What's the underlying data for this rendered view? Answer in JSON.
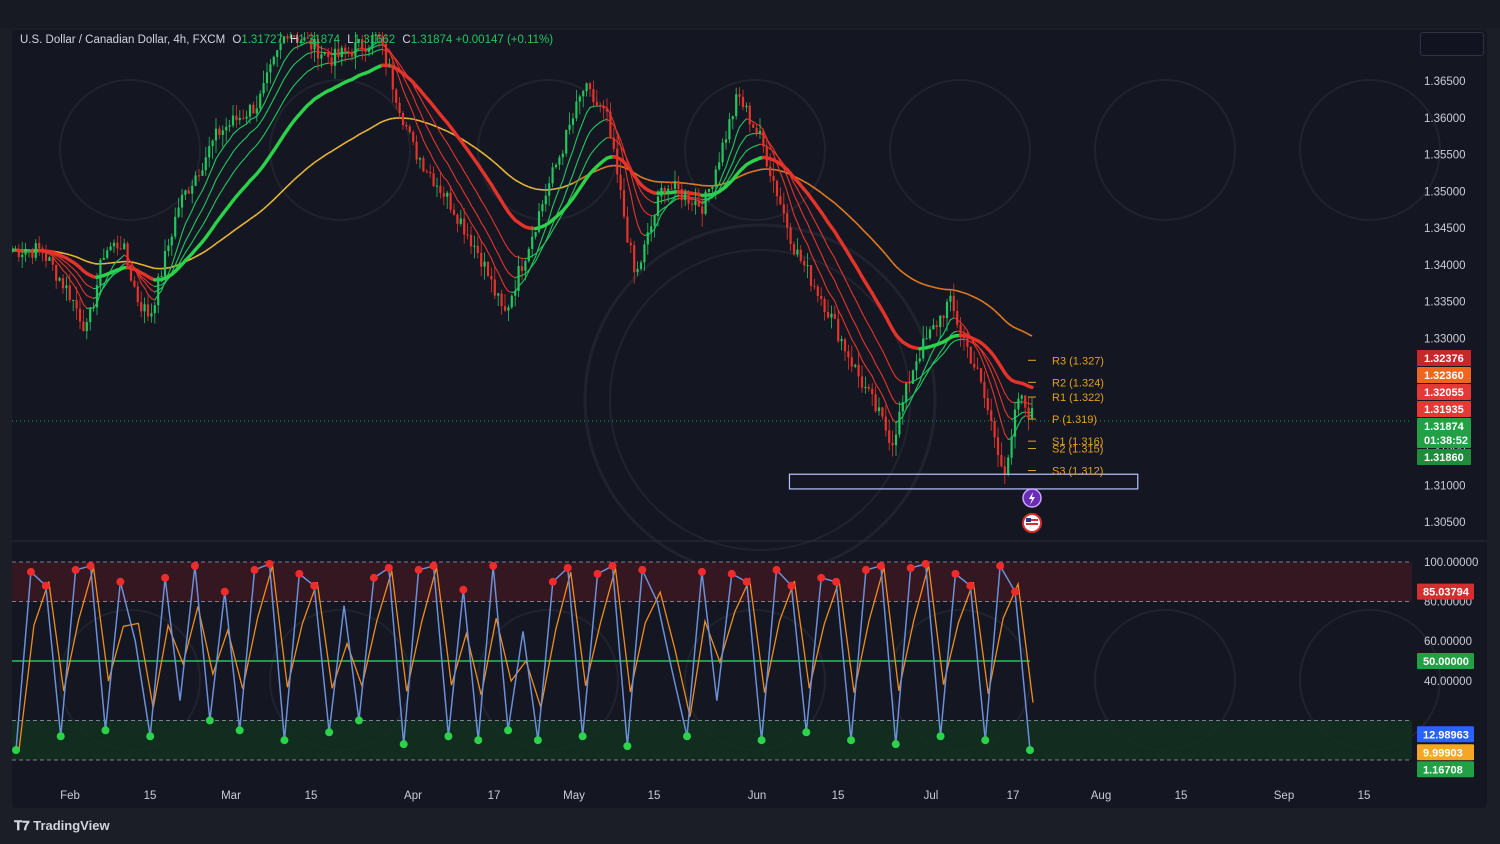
{
  "legend": {
    "symbol": "U.S. Dollar / Canadian Dollar, 4h, FXCM",
    "o_label": "O",
    "o": "1.31727",
    "h_label": "H",
    "h": "1.31874",
    "l_label": "L",
    "l": "1.31662",
    "c_label": "C",
    "c": "1.31874",
    "change": "+0.00147 (+0.11%)"
  },
  "footer": {
    "brand": "TradingView"
  },
  "colors": {
    "bull": "#22c55e",
    "bear": "#e5332a",
    "ema_yellow": "#e8b53a",
    "pivot": "#e0a020",
    "osc_blue": "#6b8fd8",
    "osc_orange": "#f08c1e",
    "zone_box": "#b8c4ff"
  },
  "chart_data": [
    {
      "type": "candlestick",
      "title": "U.S. Dollar / Canadian Dollar, 4h, FXCM",
      "ylim": [
        1.302,
        1.372
      ],
      "y_ticks": [
        "1.30500",
        "1.31000",
        "1.31500",
        "1.32000",
        "1.32500",
        "1.33000",
        "1.33500",
        "1.34000",
        "1.34500",
        "1.35000",
        "1.35500",
        "1.36000",
        "1.36500"
      ],
      "x_ticks": [
        "Feb",
        "15",
        "Mar",
        "15",
        "Apr",
        "17",
        "May",
        "15",
        "Jun",
        "15",
        "Jul",
        "17",
        "Aug",
        "15",
        "Sep",
        "15"
      ],
      "price_path": [
        {
          "x": "Jan 27",
          "y": 1.342
        },
        {
          "x": "Feb 1",
          "y": 1.336
        },
        {
          "x": "Feb 4",
          "y": 1.331
        },
        {
          "x": "Feb 7",
          "y": 1.342
        },
        {
          "x": "Feb 10",
          "y": 1.343
        },
        {
          "x": "Feb 13",
          "y": 1.335
        },
        {
          "x": "Feb 15",
          "y": 1.333
        },
        {
          "x": "Feb 20",
          "y": 1.348
        },
        {
          "x": "Feb 27",
          "y": 1.358
        },
        {
          "x": "Mar 5",
          "y": 1.362
        },
        {
          "x": "Mar 10",
          "y": 1.372
        },
        {
          "x": "Mar 18",
          "y": 1.368
        },
        {
          "x": "Mar 26",
          "y": 1.371
        },
        {
          "x": "Apr 1",
          "y": 1.356
        },
        {
          "x": "Apr 8",
          "y": 1.348
        },
        {
          "x": "Apr 13",
          "y": 1.341
        },
        {
          "x": "Apr 17",
          "y": 1.333
        },
        {
          "x": "Apr 24",
          "y": 1.349
        },
        {
          "x": "May 1",
          "y": 1.364
        },
        {
          "x": "May 5",
          "y": 1.36
        },
        {
          "x": "May 10",
          "y": 1.338
        },
        {
          "x": "May 15",
          "y": 1.351
        },
        {
          "x": "May 22",
          "y": 1.348
        },
        {
          "x": "May 28",
          "y": 1.363
        },
        {
          "x": "Jun 1",
          "y": 1.357
        },
        {
          "x": "Jun 7",
          "y": 1.342
        },
        {
          "x": "Jun 12",
          "y": 1.335
        },
        {
          "x": "Jun 18",
          "y": 1.325
        },
        {
          "x": "Jun 24",
          "y": 1.316
        },
        {
          "x": "Jun 28",
          "y": 1.327
        },
        {
          "x": "Jul 4",
          "y": 1.335
        },
        {
          "x": "Jul 9",
          "y": 1.325
        },
        {
          "x": "Jul 14",
          "y": 1.311
        },
        {
          "x": "Jul 16",
          "y": 1.322
        },
        {
          "x": "Jul 19",
          "y": 1.319
        }
      ],
      "series": [
        {
          "name": "",
          "color": "#e8b53a"
        },
        {
          "name": "",
          "color": "#22c55e"
        },
        {
          "name": "",
          "color": "#e5332a"
        }
      ],
      "demand_zone": {
        "from": "Jun 6",
        "to": "Aug 6",
        "y_low": 1.3095,
        "y_high": 1.3115
      },
      "pivots": [
        {
          "label": "R3 (1.327)",
          "value": 1.327
        },
        {
          "label": "R2 (1.324)",
          "value": 1.324
        },
        {
          "label": "R1 (1.322)",
          "value": 1.322
        },
        {
          "label": "P (1.319)",
          "value": 1.319
        },
        {
          "label": "S1 (1.316)",
          "value": 1.316
        },
        {
          "label": "S2 (1.315)",
          "value": 1.315
        },
        {
          "label": "S3 (1.312)",
          "value": 1.312
        }
      ],
      "price_tags": [
        {
          "text": "1.32376",
          "value": 1.32376,
          "color": "#c62828"
        },
        {
          "text": "1.32360",
          "value": 1.3236,
          "color": "#f0661e"
        },
        {
          "text": "1.32055",
          "value": 1.32055,
          "color": "#e53935"
        },
        {
          "text": "1.31935",
          "value": 1.31935,
          "color": "#e53935"
        },
        {
          "text": "1.31874",
          "value": 1.31874,
          "color": "#22a046",
          "sub": "01:38:52"
        },
        {
          "text": "1.31860",
          "value": 1.3186,
          "color": "#1f8c3b"
        }
      ],
      "last_price": 1.31874
    },
    {
      "type": "line",
      "title": "",
      "ylim": [
        0,
        100
      ],
      "y_ticks": [
        "100.00000",
        "80.00000",
        "60.00000",
        "40.00000"
      ],
      "bands": {
        "overbought": 80,
        "mid": 50,
        "oversold": 20
      },
      "series": [
        {
          "name": "",
          "color": "#6b8fd8",
          "values": [
            5,
            95,
            88,
            12,
            96,
            98,
            15,
            90,
            60,
            12,
            92,
            30,
            98,
            20,
            85,
            15,
            96,
            99,
            10,
            94,
            88,
            14,
            78,
            20,
            92,
            97,
            8,
            96,
            98,
            12,
            86,
            10,
            98,
            15,
            65,
            10,
            90,
            97,
            12,
            94,
            98,
            7,
            96,
            80,
            45,
            12,
            95,
            30,
            94,
            90,
            10,
            96,
            88,
            14,
            92,
            90,
            10,
            96,
            98,
            8,
            97,
            99,
            12,
            94,
            88,
            10,
            98,
            85,
            5
          ]
        }
      ],
      "price_tags": [
        {
          "text": "85.03794",
          "value": 85.03794,
          "color": "#d32f2f"
        },
        {
          "text": "50.00000",
          "value": 50,
          "color": "#22a046"
        },
        {
          "text": "12.98963",
          "value": 12.98963,
          "color": "#2962ff"
        },
        {
          "text": "9.99903",
          "value": 9.99903,
          "color": "#f5a623"
        },
        {
          "text": "1.16708",
          "value": 1.16708,
          "color": "#22a046"
        }
      ]
    }
  ]
}
